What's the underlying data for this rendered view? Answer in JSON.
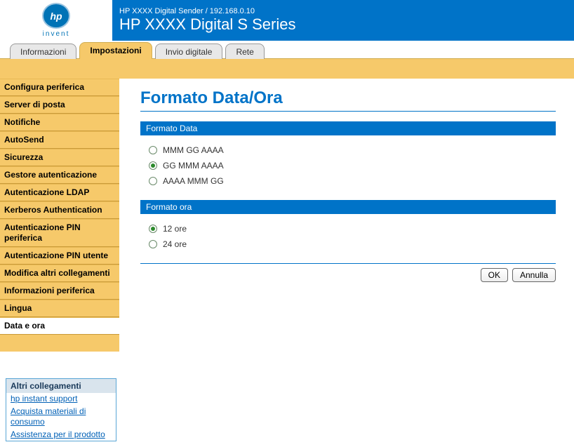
{
  "header": {
    "logo_letters": "hp",
    "logo_word": "invent",
    "breadcrumb": "HP XXXX Digital Sender / 192.168.0.10",
    "product": "HP XXXX Digital S Series"
  },
  "tabs": [
    {
      "label": "Informazioni",
      "active": false
    },
    {
      "label": "Impostazioni",
      "active": true
    },
    {
      "label": "Invio digitale",
      "active": false
    },
    {
      "label": "Rete",
      "active": false
    }
  ],
  "sidebar": {
    "items": [
      "Configura periferica",
      "Server di posta",
      "Notifiche",
      "AutoSend",
      "Sicurezza",
      "Gestore autenticazione",
      "Autenticazione LDAP",
      "Kerberos Authentication",
      "Autenticazione PIN periferica",
      "Autenticazione PIN utente",
      "Modifica altri collegamenti",
      "Informazioni periferica",
      "Lingua",
      "Data e ora"
    ],
    "active_index": 13
  },
  "page": {
    "title": "Formato Data/Ora",
    "section_date": "Formato Data",
    "date_options": [
      {
        "label": "MMM GG AAAA",
        "checked": false
      },
      {
        "label": "GG MMM AAAA",
        "checked": true
      },
      {
        "label": "AAAA MMM GG",
        "checked": false
      }
    ],
    "section_time": "Formato ora",
    "time_options": [
      {
        "label": "12 ore",
        "checked": true
      },
      {
        "label": "24 ore",
        "checked": false
      }
    ],
    "ok": "OK",
    "cancel": "Annulla"
  },
  "other_links": {
    "title": "Altri collegamenti",
    "items": [
      "hp instant support",
      "Acquista materiali di consumo",
      "Assistenza per il prodotto"
    ]
  }
}
